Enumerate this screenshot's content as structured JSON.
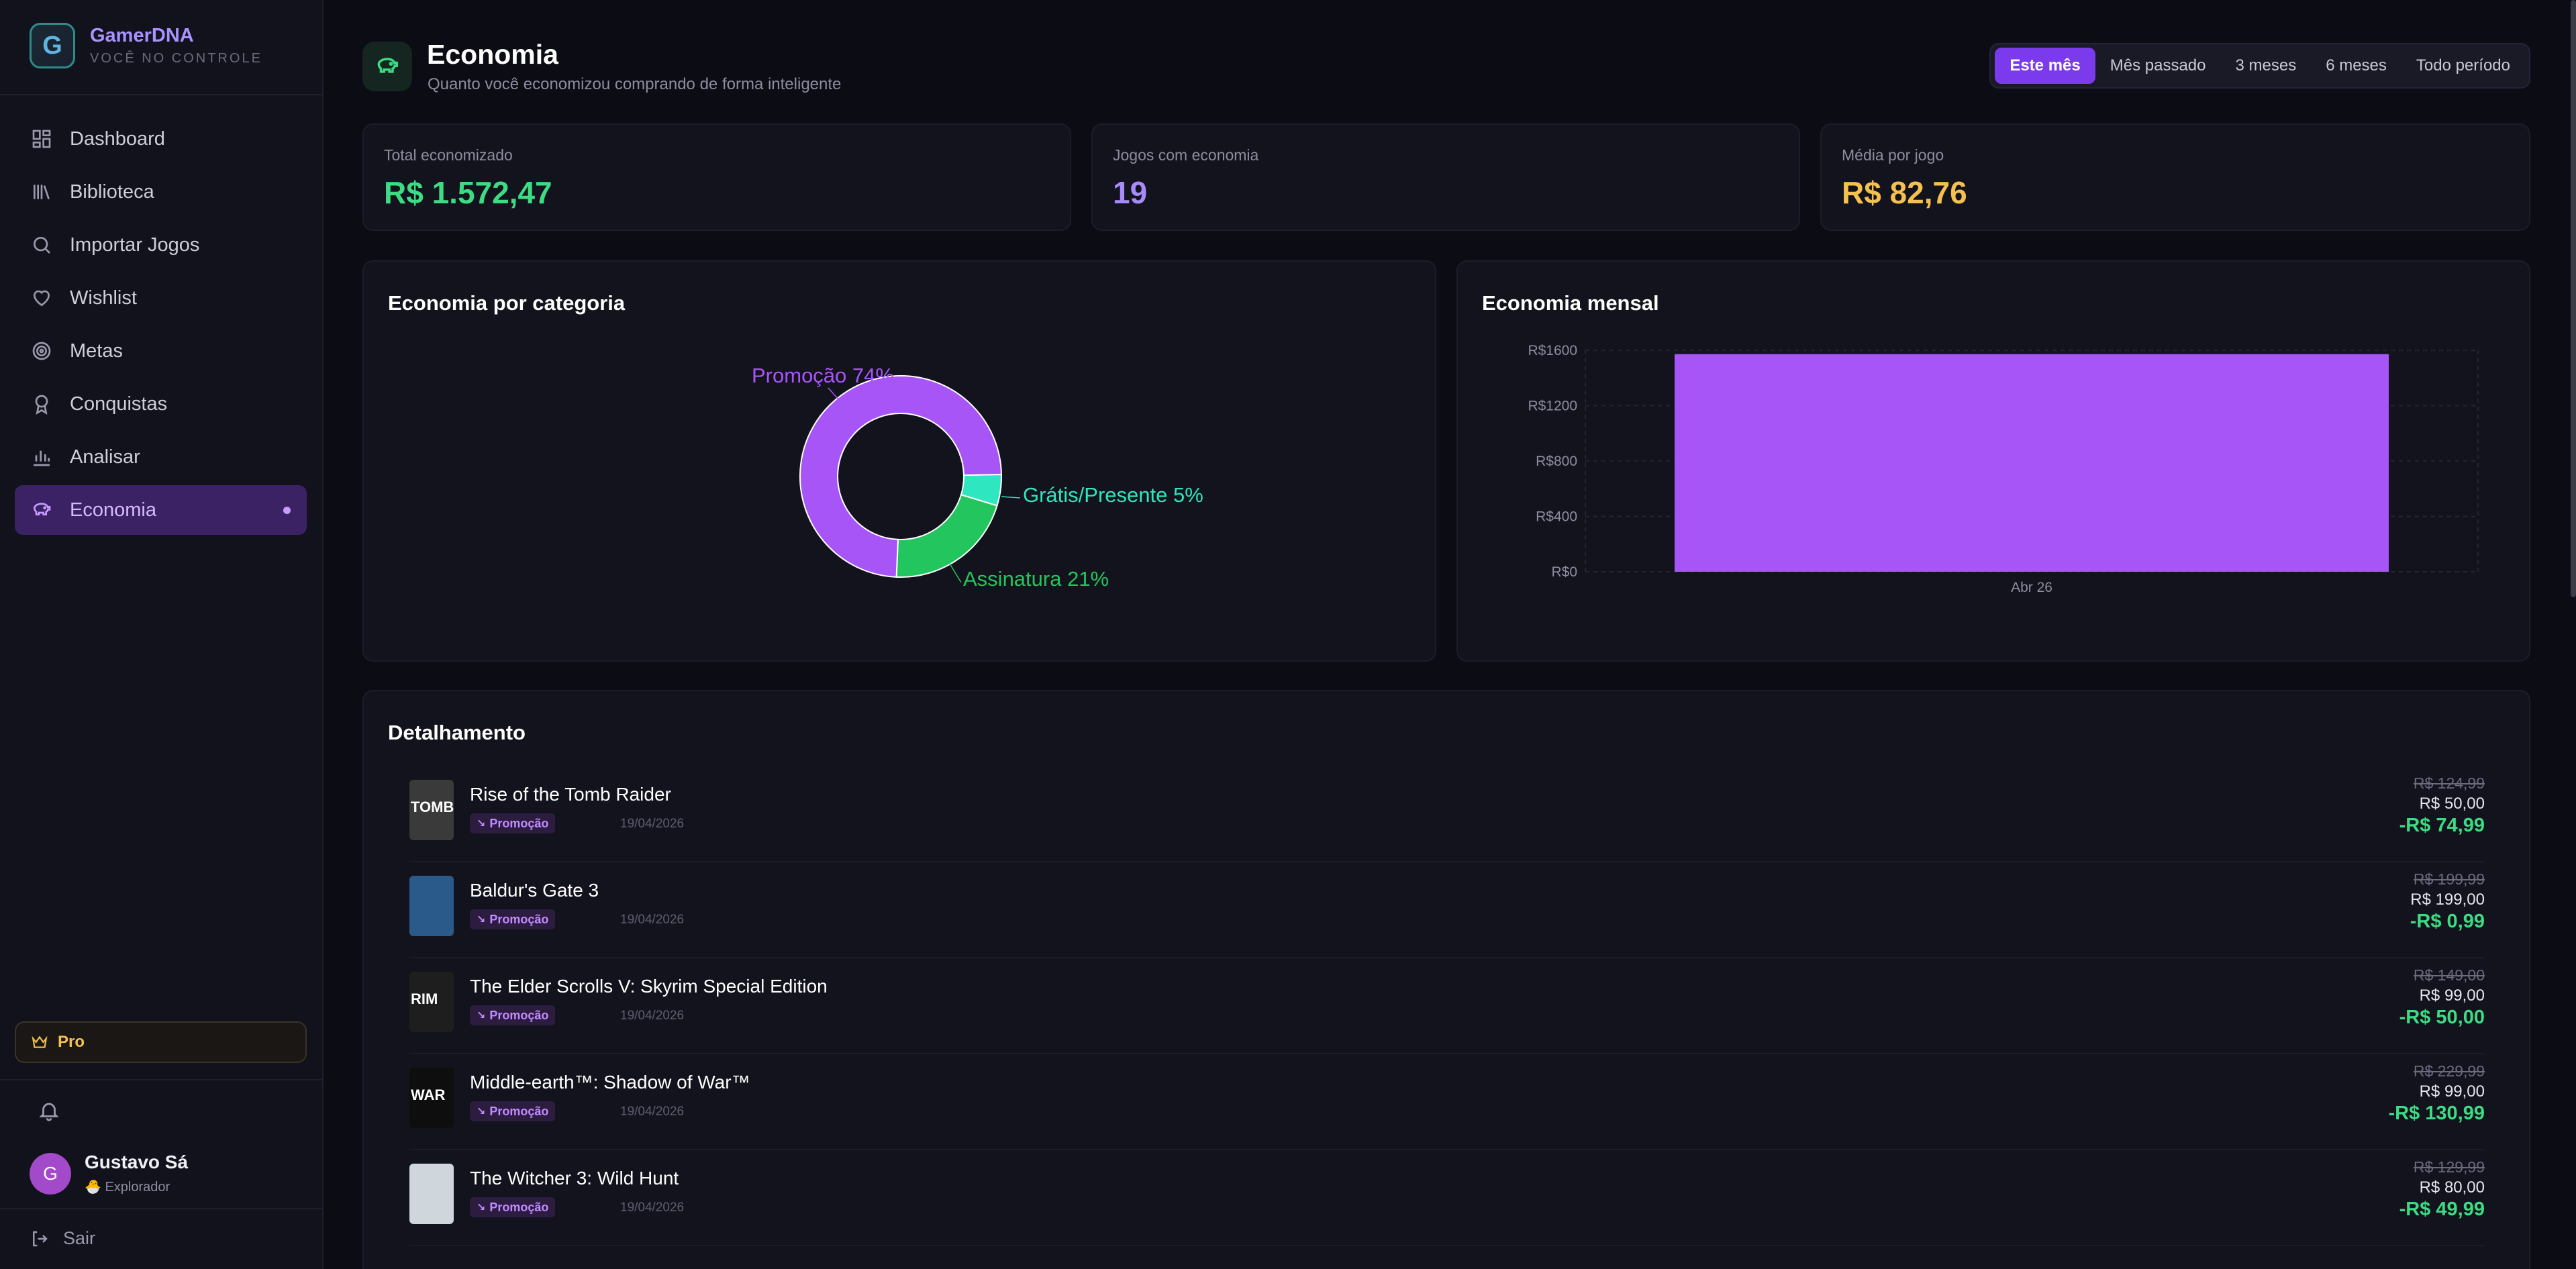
{
  "sidebar": {
    "brand": {
      "logo_letter": "G",
      "name": "GamerDNA",
      "tagline": "VOCÊ NO CONTROLE"
    },
    "items": [
      {
        "label": "Dashboard",
        "icon": "dashboard-icon"
      },
      {
        "label": "Biblioteca",
        "icon": "library-icon"
      },
      {
        "label": "Importar Jogos",
        "icon": "search-icon"
      },
      {
        "label": "Wishlist",
        "icon": "heart-icon"
      },
      {
        "label": "Metas",
        "icon": "target-icon"
      },
      {
        "label": "Conquistas",
        "icon": "award-icon"
      },
      {
        "label": "Analisar",
        "icon": "bar-chart-icon"
      },
      {
        "label": "Economia",
        "icon": "piggy-bank-icon",
        "active": true
      }
    ],
    "pro_label": "Pro",
    "user": {
      "initial": "G",
      "name": "Gustavo Sá",
      "role": "🐣 Explorador"
    },
    "logout_label": "Sair"
  },
  "header": {
    "title": "Economia",
    "subtitle": "Quanto você economizou comprando de forma inteligente",
    "periods": [
      "Este mês",
      "Mês passado",
      "3 meses",
      "6 meses",
      "Todo período"
    ],
    "active_period": "Este mês"
  },
  "stats": [
    {
      "label": "Total economizado",
      "value": "R$ 1.572,47",
      "color": "#3ddc84"
    },
    {
      "label": "Jogos com economia",
      "value": "19",
      "color": "#a78bfa"
    },
    {
      "label": "Média por jogo",
      "value": "R$ 82,76",
      "color": "#f4c14e"
    }
  ],
  "category_card": {
    "title": "Economia por categoria"
  },
  "monthly_card": {
    "title": "Economia mensal"
  },
  "chart_data": [
    {
      "type": "pie",
      "title": "Economia por categoria",
      "slices": [
        {
          "label": "Promoção 74%",
          "value": 74,
          "color": "#a855f7"
        },
        {
          "label": "Grátis/Presente 5%",
          "value": 5,
          "color": "#2ee6c0"
        },
        {
          "label": "Assinatura 21%",
          "value": 21,
          "color": "#22c55e"
        }
      ]
    },
    {
      "type": "bar",
      "title": "Economia mensal",
      "categories": [
        "Abr 26"
      ],
      "values": [
        1572.47
      ],
      "ylim": [
        0,
        1600
      ],
      "yticks": [
        "R$0",
        "R$400",
        "R$800",
        "R$1200",
        "R$1600"
      ],
      "color": "#a855f7",
      "grid": true
    }
  ],
  "details": {
    "title": "Detalhamento",
    "rows": [
      {
        "name": "Rise of the Tomb Raider",
        "tag": "Promoção",
        "date": "19/04/2026",
        "old": "R$ 124,99",
        "new": "R$ 50,00",
        "save": "-R$ 74,99",
        "thumb_text": "TOMB",
        "thumb_color": "#3a3a3a"
      },
      {
        "name": "Baldur's Gate 3",
        "tag": "Promoção",
        "date": "19/04/2026",
        "old": "R$ 199,99",
        "new": "R$ 199,00",
        "save": "-R$ 0,99",
        "thumb_text": "",
        "thumb_color": "#2a5a8a"
      },
      {
        "name": "The Elder Scrolls V: Skyrim Special Edition",
        "tag": "Promoção",
        "date": "19/04/2026",
        "old": "R$ 149,00",
        "new": "R$ 99,00",
        "save": "-R$ 50,00",
        "thumb_text": "RIM",
        "thumb_color": "#1e1e1e"
      },
      {
        "name": "Middle-earth™: Shadow of War™",
        "tag": "Promoção",
        "date": "19/04/2026",
        "old": "R$ 229,99",
        "new": "R$ 99,00",
        "save": "-R$ 130,99",
        "thumb_text": "WAR",
        "thumb_color": "#0e0e0e"
      },
      {
        "name": "The Witcher 3: Wild Hunt",
        "tag": "Promoção",
        "date": "19/04/2026",
        "old": "R$ 129,99",
        "new": "R$ 80,00",
        "save": "-R$ 49,99",
        "thumb_text": "",
        "thumb_color": "#cfd6dc"
      }
    ]
  }
}
